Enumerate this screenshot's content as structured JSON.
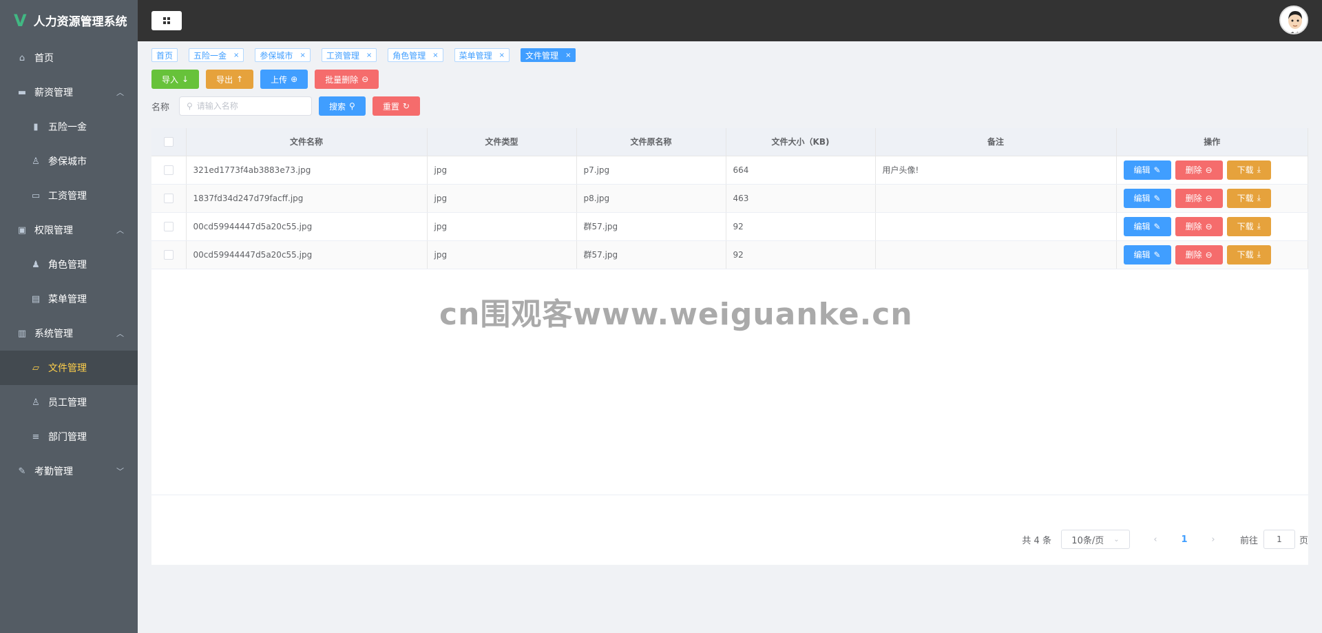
{
  "app": {
    "title": "人力资源管理系统"
  },
  "sidebar": {
    "items": [
      {
        "label": "首页",
        "icon": "home-icon",
        "level": 0
      },
      {
        "label": "薪资管理",
        "icon": "wallet-icon",
        "level": 0,
        "expandable": true
      },
      {
        "label": "五险一金",
        "icon": "bar-chart-icon",
        "level": 1
      },
      {
        "label": "参保城市",
        "icon": "user-icon",
        "level": 1
      },
      {
        "label": "工资管理",
        "icon": "data-board-icon",
        "level": 1
      },
      {
        "label": "权限管理",
        "icon": "briefcase-icon",
        "level": 0,
        "expandable": true
      },
      {
        "label": "角色管理",
        "icon": "user-solid-icon",
        "level": 1
      },
      {
        "label": "菜单管理",
        "icon": "notebook-icon",
        "level": 1
      },
      {
        "label": "系统管理",
        "icon": "office-building-icon",
        "level": 0,
        "expandable": true
      },
      {
        "label": "文件管理",
        "icon": "folder-icon",
        "level": 1,
        "active": true
      },
      {
        "label": "员工管理",
        "icon": "user-icon",
        "level": 1
      },
      {
        "label": "部门管理",
        "icon": "sliders-icon",
        "level": 1
      },
      {
        "label": "考勤管理",
        "icon": "edit-pen-icon",
        "level": 0,
        "expandable": true,
        "collapsed": true
      }
    ]
  },
  "tags": [
    {
      "label": "首页",
      "closable": false
    },
    {
      "label": "五险一金",
      "closable": true
    },
    {
      "label": "参保城市",
      "closable": true
    },
    {
      "label": "工资管理",
      "closable": true
    },
    {
      "label": "角色管理",
      "closable": true
    },
    {
      "label": "菜单管理",
      "closable": true
    },
    {
      "label": "文件管理",
      "closable": true,
      "active": true
    }
  ],
  "toolbar": {
    "import_label": "导入",
    "export_label": "导出",
    "upload_label": "上传",
    "batch_delete_label": "批量删除"
  },
  "search": {
    "label": "名称",
    "placeholder": "请输入名称",
    "value": "",
    "search_label": "搜索",
    "reset_label": "重置"
  },
  "table": {
    "columns": [
      "文件名称",
      "文件类型",
      "文件原名称",
      "文件大小（KB)",
      "备注",
      "操作"
    ],
    "rows": [
      {
        "name": "321ed1773f4ab3883e73.jpg",
        "type": "jpg",
        "original": "p7.jpg",
        "size": "664",
        "remark": "用户头像!"
      },
      {
        "name": "1837fd34d247d79facff.jpg",
        "type": "jpg",
        "original": "p8.jpg",
        "size": "463",
        "remark": ""
      },
      {
        "name": "00cd59944447d5a20c55.jpg",
        "type": "jpg",
        "original": "群57.jpg",
        "size": "92",
        "remark": ""
      },
      {
        "name": "00cd59944447d5a20c55.jpg",
        "type": "jpg",
        "original": "群57.jpg",
        "size": "92",
        "remark": ""
      }
    ],
    "edit_label": "编辑",
    "delete_label": "删除",
    "download_label": "下载"
  },
  "pagination": {
    "total_text": "共 4 条",
    "page_size": "10条/页",
    "current_page": "1",
    "goto_label": "前往",
    "goto_value": "1",
    "page_suffix": "页"
  },
  "watermark": "cn围观客www.weiguanke.cn",
  "colors": {
    "success": "#67c23a",
    "warning": "#e6a23c",
    "primary": "#409eff",
    "danger": "#f56c6c",
    "sidebar_bg": "#545c64",
    "active_text": "#ffd04b"
  }
}
